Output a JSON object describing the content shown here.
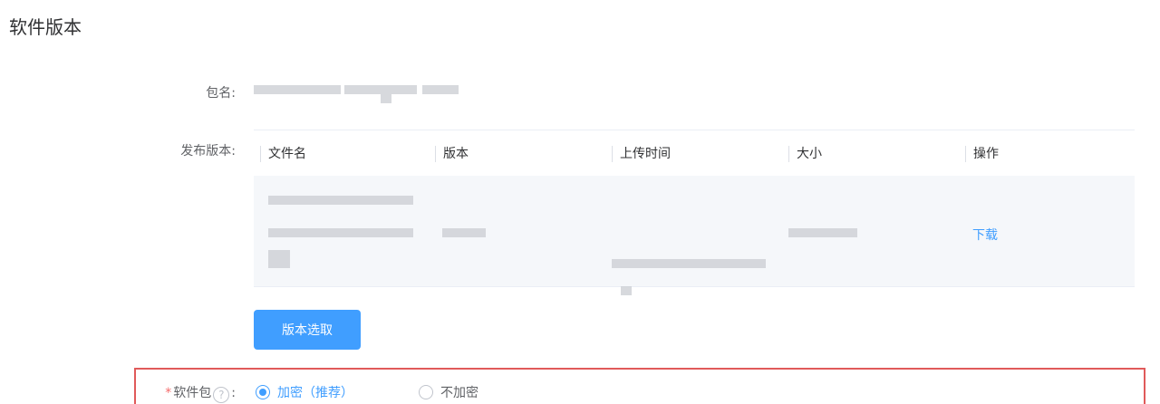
{
  "page_title": "软件版本",
  "labels": {
    "package_name": "包名:",
    "release_version": "发布版本:",
    "software_package": "软件包",
    "colon": ":"
  },
  "table": {
    "headers": [
      "文件名",
      "版本",
      "上传时间",
      "大小",
      "操作"
    ],
    "row_action": "下载"
  },
  "buttons": {
    "select_version": "版本选取"
  },
  "radio_options": [
    {
      "label": "加密（推荐）",
      "checked": true
    },
    {
      "label": "不加密",
      "checked": false
    }
  ],
  "colors": {
    "accent": "#409eff",
    "required": "#f56c6c",
    "highlight_border": "#e05a5a"
  }
}
